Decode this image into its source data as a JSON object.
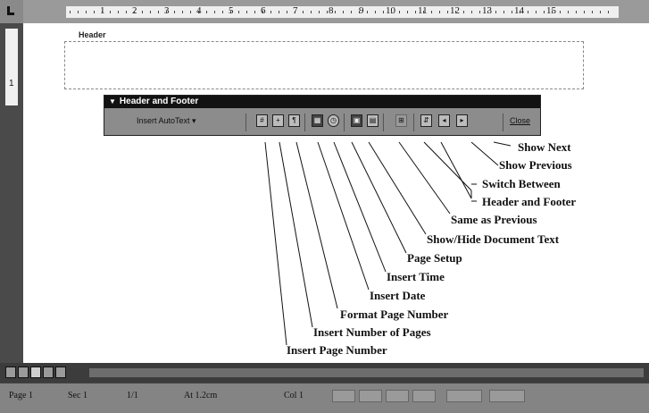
{
  "ruler": {
    "numbers": [
      "1",
      "2",
      "3",
      "4",
      "5",
      "6",
      "7",
      "8",
      "9",
      "10",
      "11",
      "12",
      "13",
      "14",
      "15"
    ],
    "vertical_number": "1"
  },
  "document": {
    "header_label": "Header"
  },
  "toolbar": {
    "title": "Header and Footer",
    "insert_autotext": "Insert AutoText ▾",
    "close": "Close"
  },
  "callouts": {
    "show_next": "Show Next",
    "show_previous": "Show Previous",
    "switch_between_1": "Switch Between",
    "switch_between_2": "Header and Footer",
    "same_as_previous": "Same as Previous",
    "show_hide_text": "Show/Hide Document Text",
    "page_setup": "Page Setup",
    "insert_time": "Insert Time",
    "insert_date": "Insert Date",
    "format_page_number": "Format Page Number",
    "insert_number_of_pages": "Insert Number of Pages",
    "insert_page_number": "Insert Page Number"
  },
  "status": {
    "page": "Page 1",
    "sec": "Sec 1",
    "pages": "1/1",
    "at": "At 1.2cm",
    "col": "Col 1"
  }
}
